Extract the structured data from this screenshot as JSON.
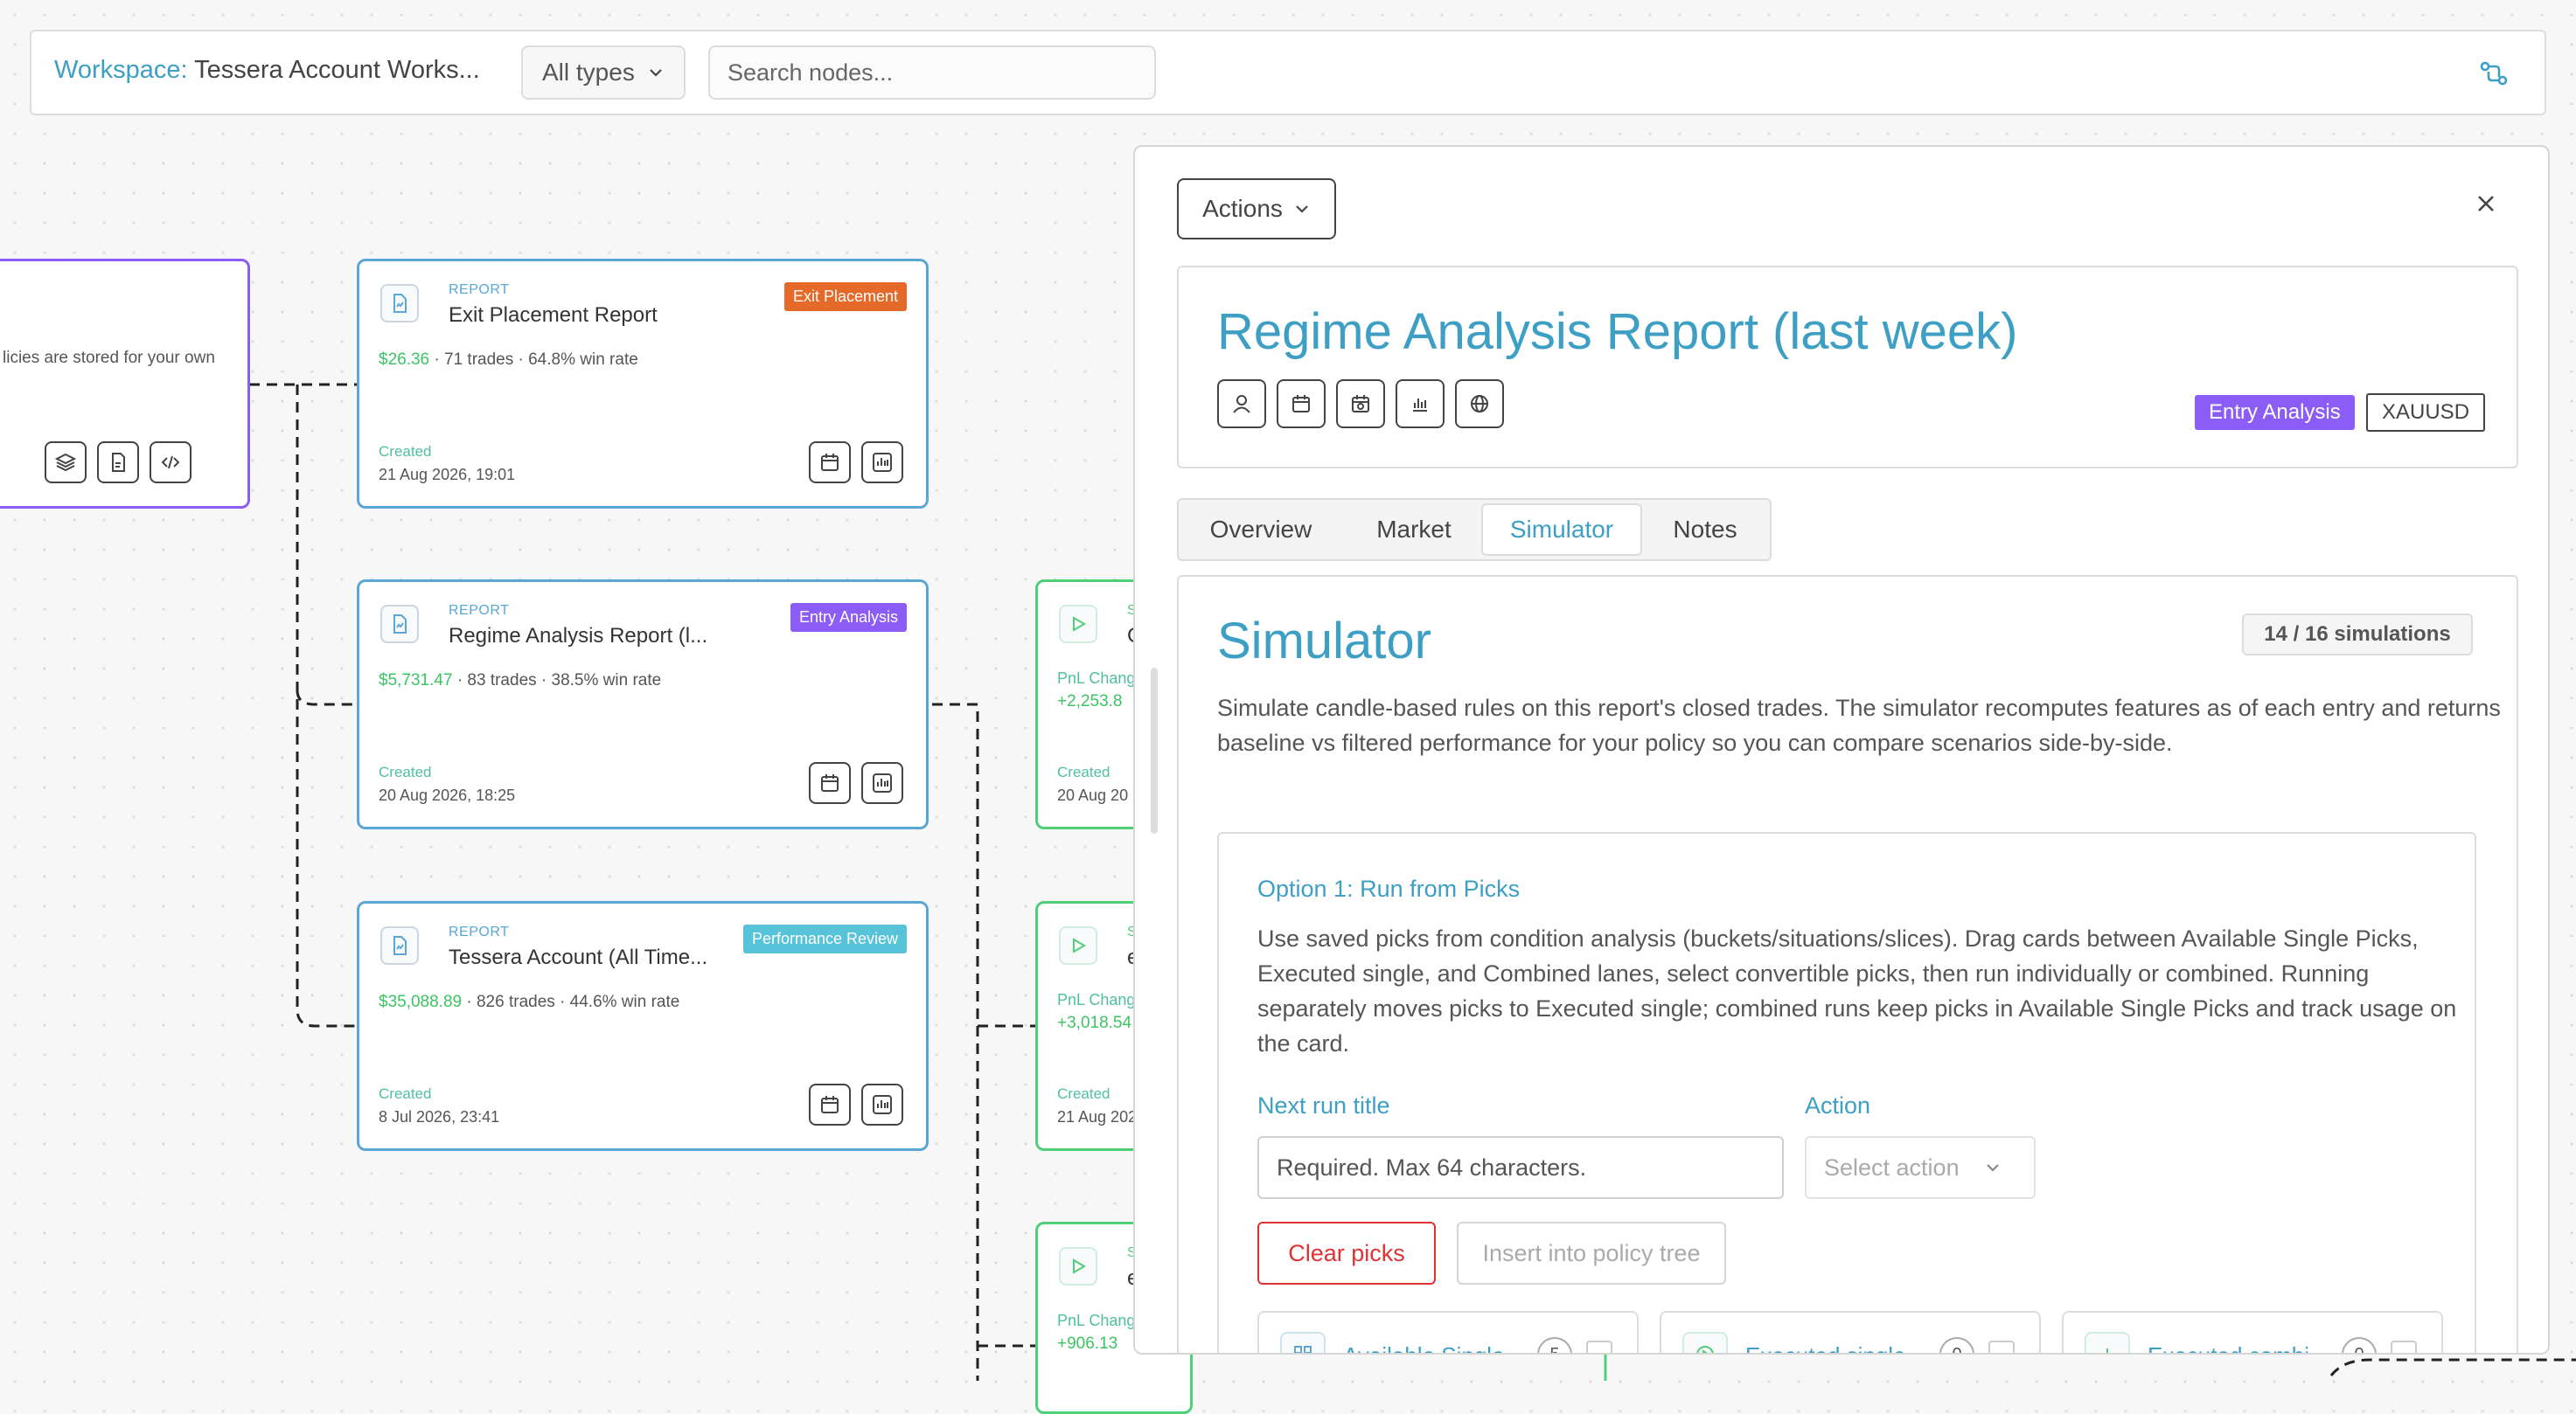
{
  "topbar": {
    "workspace_key": "Workspace:",
    "workspace_value": "Tessera Account Works...",
    "type_filter": "All types",
    "search_placeholder": "Search nodes..."
  },
  "left_card": {
    "text": "licies are stored for your own"
  },
  "report_cards": [
    {
      "kind": "REPORT",
      "title": "Exit Placement Report",
      "badge": "Exit Placement",
      "badge_color": "#e56a2a",
      "pnl": "$26.36",
      "stats": "· 71 trades · 64.8% win rate",
      "created_label": "Created",
      "created": "21 Aug 2026, 19:01"
    },
    {
      "kind": "REPORT",
      "title": "Regime Analysis Report (l...",
      "badge": "Entry Analysis",
      "badge_color": "#8b5cf6",
      "pnl": "$5,731.47",
      "stats": "· 83 trades · 38.5% win rate",
      "created_label": "Created",
      "created": "20 Aug 2026, 18:25"
    },
    {
      "kind": "REPORT",
      "title": "Tessera Account (All Time...",
      "badge": "Performance Review",
      "badge_color": "#56c3d8",
      "pnl": "$35,088.89",
      "stats": "· 826 trades · 44.6% win rate",
      "created_label": "Created",
      "created": "8 Jul 2026, 23:41"
    }
  ],
  "sim_cards": [
    {
      "kind": "S",
      "title": "C",
      "pnl_label": "PnL Chang",
      "pnl": "+2,253.8",
      "created_label": "Created",
      "created": "20 Aug 20"
    },
    {
      "kind": "S",
      "title": "e",
      "pnl_label": "PnL Chang",
      "pnl": "+3,018.54",
      "created_label": "Created",
      "created": "21 Aug 202"
    },
    {
      "kind": "S",
      "title": "e",
      "pnl_label": "PnL Chang",
      "pnl": "+906.13"
    }
  ],
  "panel": {
    "actions_label": "Actions",
    "title": "Regime Analysis Report (last week)",
    "tags": [
      {
        "label": "Entry Analysis",
        "color": "#8b5cf6"
      },
      {
        "label": "XAUUSD"
      }
    ],
    "tabs": [
      "Overview",
      "Market",
      "Simulator",
      "Notes"
    ],
    "active_tab": "Simulator",
    "simulator": {
      "heading": "Simulator",
      "count": "14 / 16 simulations",
      "description": "Simulate candle-based rules on this report's closed trades. The simulator recomputes features as of each entry and returns baseline vs filtered performance for your policy so you can compare scenarios side-by-side.",
      "option_title": "Option 1: Run from Picks",
      "option_desc": "Use saved picks from condition analysis (buckets/situations/slices). Drag cards between Available Single Picks, Executed single, and Combined lanes, select convertible picks, then run individually or combined. Running separately moves picks to Executed single; combined runs keep picks in Available Single Picks and track usage on the card.",
      "run_title_label": "Next run title",
      "run_title_placeholder": "Required. Max 64 characters.",
      "action_label": "Action",
      "action_placeholder": "Select action",
      "clear_button": "Clear picks",
      "insert_button": "Insert into policy tree",
      "lanes": [
        {
          "label": "Available Single",
          "count": "5"
        },
        {
          "label": "Executed single",
          "count": "0"
        },
        {
          "label": "Executed combi",
          "count": "0"
        }
      ]
    }
  },
  "colors": {
    "accent": "#3d9fc3",
    "report_border": "#5aa7d6",
    "sim_border": "#4fcf78",
    "pnl": "#3cc464",
    "danger": "#d33"
  }
}
